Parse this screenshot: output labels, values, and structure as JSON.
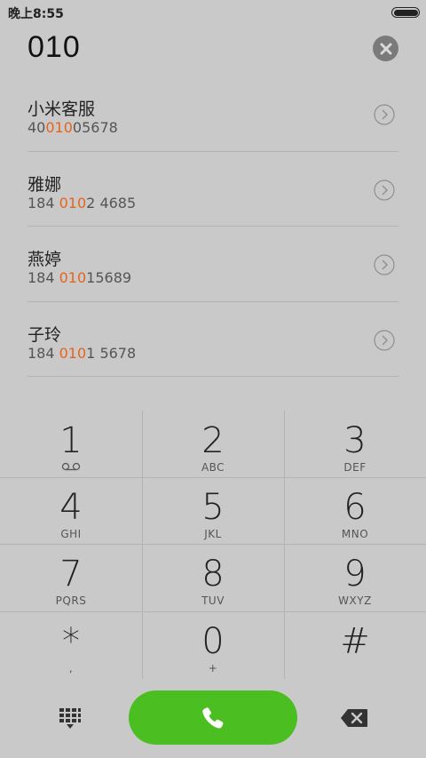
{
  "status_bar": {
    "time": "晚上8:55"
  },
  "dial_input": {
    "number": "010"
  },
  "results": [
    {
      "name": "小米客服",
      "number_parts": [
        "40",
        "010",
        "05678"
      ]
    },
    {
      "name": "雅娜",
      "number_parts": [
        "184 ",
        "010",
        "2 4685"
      ]
    },
    {
      "name": "燕婷",
      "number_parts": [
        "184 ",
        "010",
        "15689"
      ]
    },
    {
      "name": "子玲",
      "number_parts": [
        "184 ",
        "010",
        "1 5678"
      ]
    }
  ],
  "keypad": {
    "keys": [
      {
        "digit": "1",
        "letters": ""
      },
      {
        "digit": "2",
        "letters": "ABC"
      },
      {
        "digit": "3",
        "letters": "DEF"
      },
      {
        "digit": "4",
        "letters": "GHI"
      },
      {
        "digit": "5",
        "letters": "JKL"
      },
      {
        "digit": "6",
        "letters": "MNO"
      },
      {
        "digit": "7",
        "letters": "PQRS"
      },
      {
        "digit": "8",
        "letters": "TUV"
      },
      {
        "digit": "9",
        "letters": "WXYZ"
      },
      {
        "digit": "*",
        "letters": ","
      },
      {
        "digit": "0",
        "letters": "+"
      },
      {
        "digit": "#",
        "letters": ""
      }
    ]
  },
  "colors": {
    "background": "#c9c9c9",
    "highlight": "#e8631a",
    "call_button": "#4bbf22",
    "divider": "#b3b3b3"
  },
  "icons": {
    "clear": "clear-circle-x-icon",
    "detail": "chevron-right-circle-icon",
    "voicemail": "voicemail-icon",
    "dialpad": "dialpad-grid-icon",
    "call": "phone-handset-icon",
    "backspace": "backspace-icon"
  }
}
